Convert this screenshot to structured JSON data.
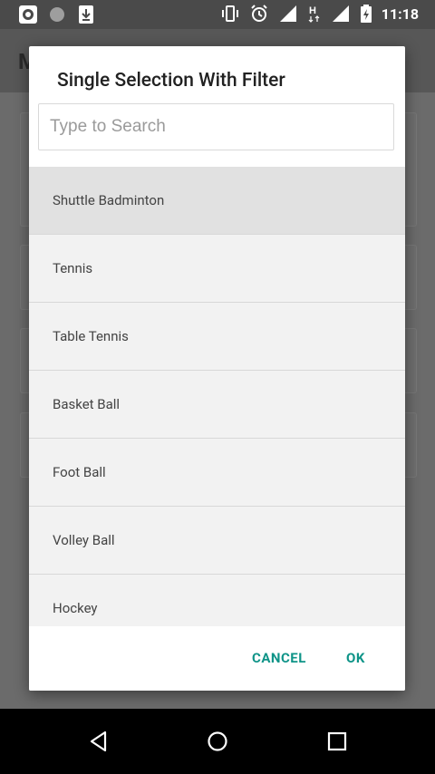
{
  "status_bar": {
    "time": "11:18",
    "left_icons": [
      "record-icon",
      "circle-icon",
      "download-icon"
    ],
    "right_icons": [
      "vibrate-icon",
      "alarm-icon",
      "signal-icon",
      "data-h-icon",
      "signal-icon",
      "battery-icon"
    ]
  },
  "background_app": {
    "title_initial": "M"
  },
  "dialog": {
    "title": "Single Selection With Filter",
    "search_placeholder": "Type to Search",
    "items": [
      {
        "label": "Shuttle Badminton",
        "selected": true
      },
      {
        "label": "Tennis",
        "selected": false
      },
      {
        "label": "Table Tennis",
        "selected": false
      },
      {
        "label": "Basket Ball",
        "selected": false
      },
      {
        "label": "Foot Ball",
        "selected": false
      },
      {
        "label": "Volley Ball",
        "selected": false
      },
      {
        "label": "Hockey",
        "selected": false
      }
    ],
    "cancel_label": "CANCEL",
    "ok_label": "OK",
    "accent_color": "#0f9488"
  },
  "nav_bar": {
    "icons": [
      "back-icon",
      "home-icon",
      "recents-icon"
    ]
  }
}
